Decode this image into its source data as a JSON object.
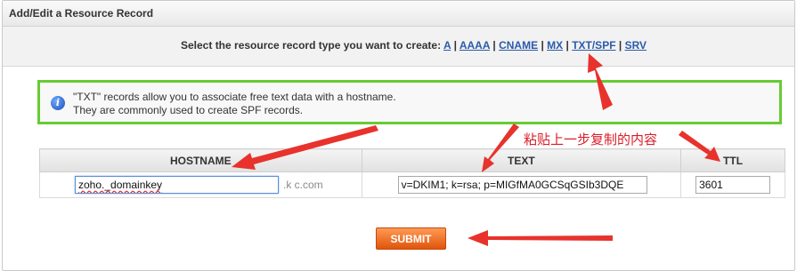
{
  "panel": {
    "title": "Add/Edit a Resource Record"
  },
  "type_selector": {
    "prompt": "Select the resource record type you want to create:",
    "types": [
      "A",
      "AAAA",
      "CNAME",
      "MX",
      "TXT/SPF",
      "SRV"
    ],
    "separator": "|"
  },
  "info": {
    "icon": "info-icon",
    "line1": "\"TXT\" records allow you to associate free text data with a hostname.",
    "line2": "They are commonly used to create SPF records."
  },
  "annotation": {
    "text": "粘贴上一步复制的内容",
    "color": "#d81e2a"
  },
  "table": {
    "headers": {
      "hostname": "HOSTNAME",
      "text": "TEXT",
      "ttl": "TTL"
    },
    "row": {
      "hostname": "zoho._domainkey",
      "domain_suffix": ".k    c.com",
      "text": "v=DKIM1; k=rsa; p=MIGfMA0GCSqGSIb3DQE",
      "ttl": "3601"
    }
  },
  "submit_label": "SUBMIT",
  "colors": {
    "accent_green": "#66cc33",
    "submit_orange": "#e0540b",
    "link_blue": "#2b5ba9",
    "arrow_red": "#e8322c"
  }
}
